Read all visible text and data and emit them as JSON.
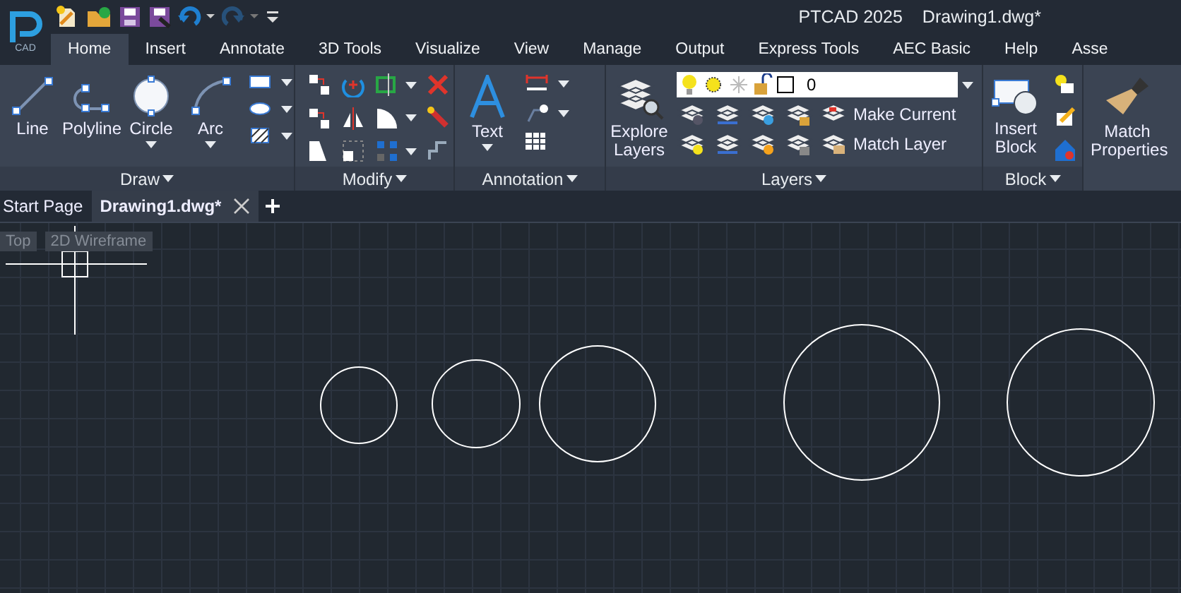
{
  "logo_text": "CAD",
  "title_bar": {
    "app": "PTCAD  2025",
    "document": "Drawing1.dwg*"
  },
  "ribbon_tabs": [
    {
      "label": "Home",
      "selected": true
    },
    {
      "label": "Insert",
      "selected": false
    },
    {
      "label": "Annotate",
      "selected": false
    },
    {
      "label": "3D Tools",
      "selected": false
    },
    {
      "label": "Visualize",
      "selected": false
    },
    {
      "label": "View",
      "selected": false
    },
    {
      "label": "Manage",
      "selected": false
    },
    {
      "label": "Output",
      "selected": false
    },
    {
      "label": "Express Tools",
      "selected": false
    },
    {
      "label": "AEC Basic",
      "selected": false
    },
    {
      "label": "Help",
      "selected": false
    },
    {
      "label": "Asse",
      "selected": false
    }
  ],
  "draw_panel": {
    "title": "Draw",
    "tools": [
      {
        "label": "Line",
        "dropdown": false
      },
      {
        "label": "Polyline",
        "dropdown": false
      },
      {
        "label": "Circle",
        "dropdown": true
      },
      {
        "label": "Arc",
        "dropdown": true
      }
    ]
  },
  "modify_panel": {
    "title": "Modify"
  },
  "annotation_panel": {
    "title": "Annotation",
    "tool": "Text"
  },
  "layers_panel": {
    "title": "Layers",
    "explore": "Explore Layers",
    "layer_value": "0",
    "buttons": [
      "Make Current",
      "Match Layer"
    ]
  },
  "block_panel": {
    "title": "Block",
    "tool": "Insert Block"
  },
  "match_panel": {
    "tool": "Match Properties"
  },
  "doc_tabs": [
    {
      "label": "Start Page",
      "selected": false
    },
    {
      "label": "Drawing1.dwg*",
      "selected": true
    }
  ],
  "viewport_labels": [
    "Top",
    "2D Wireframe"
  ]
}
